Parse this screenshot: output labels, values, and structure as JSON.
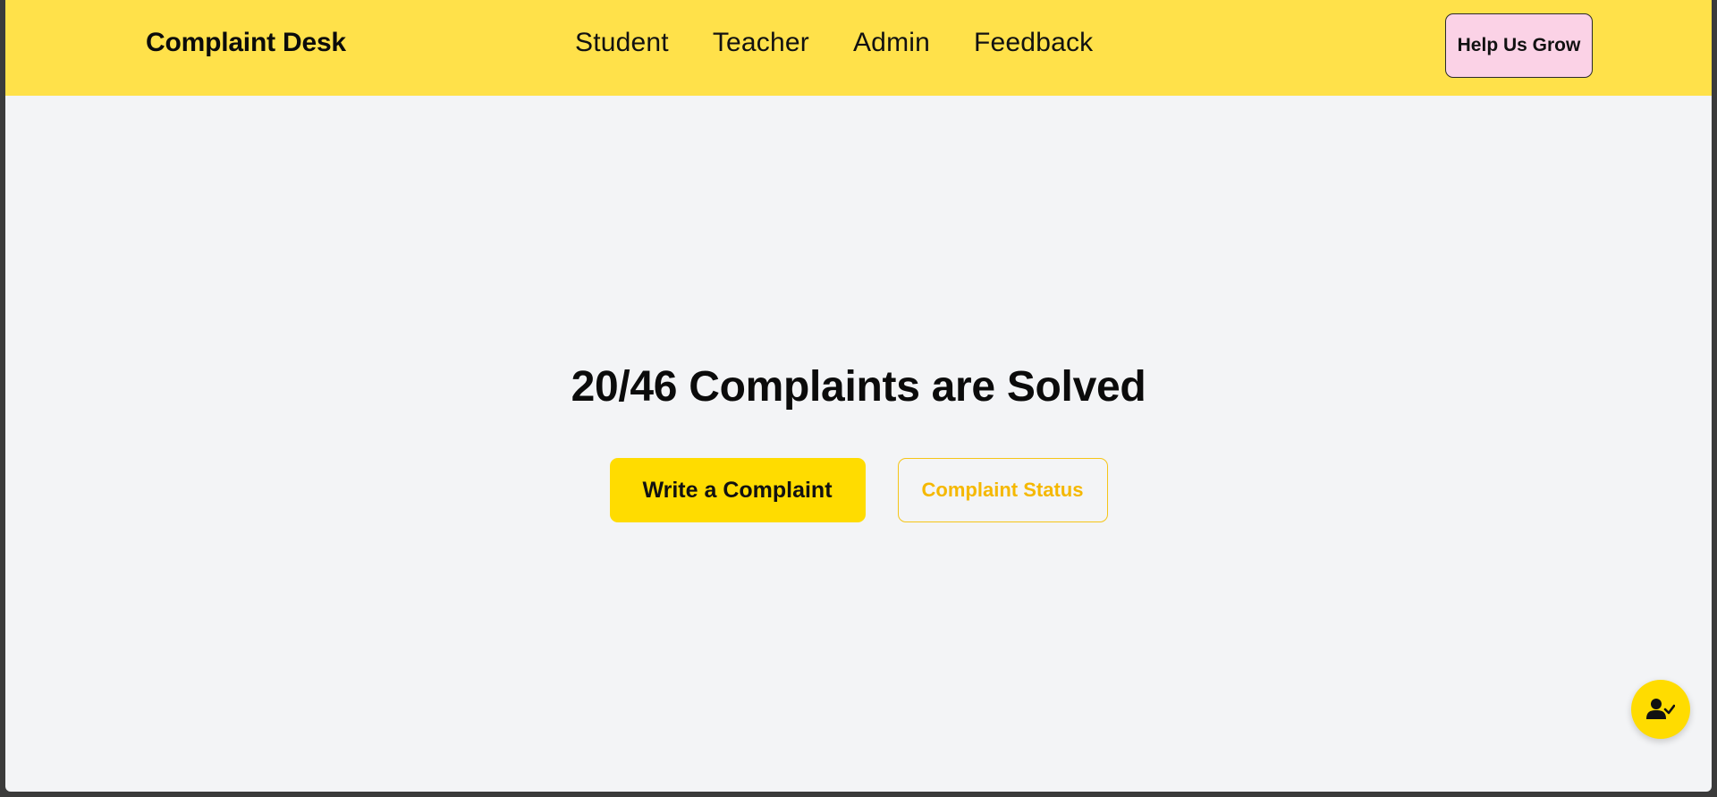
{
  "navbar": {
    "brand": "Complaint Desk",
    "links": [
      {
        "label": "Student"
      },
      {
        "label": "Teacher"
      },
      {
        "label": "Admin"
      },
      {
        "label": "Feedback"
      }
    ],
    "cta_label": "Help Us Grow"
  },
  "hero": {
    "solved": 20,
    "total": 46,
    "title": "20/46 Complaints are Solved",
    "primary_button": "Write a Complaint",
    "secondary_button": "Complaint Status"
  },
  "fab": {
    "icon": "user-check-icon"
  },
  "colors": {
    "navbar_bg": "#ffe14a",
    "page_bg": "#f3f4f6",
    "accent": "#ffdc00",
    "accent_text": "#f5b800",
    "cta_bg": "#fbd2e6"
  }
}
